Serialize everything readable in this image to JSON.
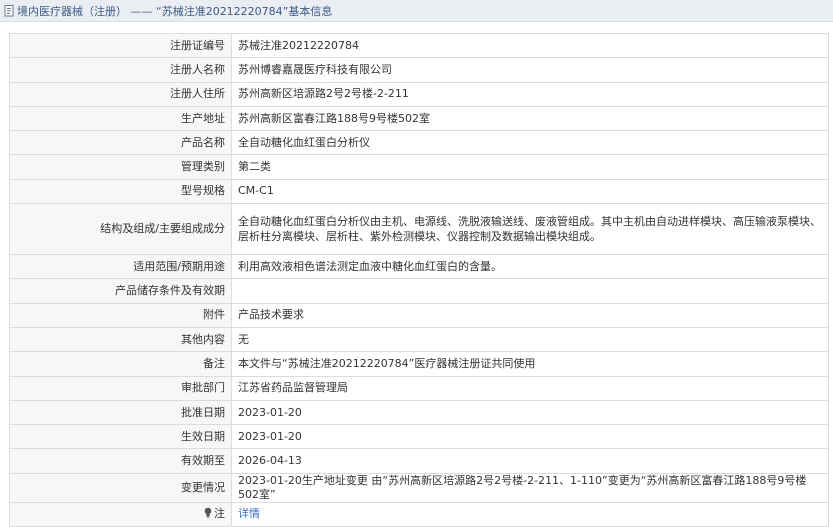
{
  "header": {
    "title": "境内医疗器械（注册） —— “苏械注准20212220784”基本信息"
  },
  "rows": [
    {
      "label": "注册证编号",
      "value": "苏械注准20212220784"
    },
    {
      "label": "注册人名称",
      "value": "苏州博睿嘉晟医疗科技有限公司"
    },
    {
      "label": "注册人住所",
      "value": "苏州高新区培源路2号2号楼-2-211"
    },
    {
      "label": "生产地址",
      "value": "苏州高新区富春江路188号9号楼502室"
    },
    {
      "label": "产品名称",
      "value": "全自动糖化血红蛋白分析仪"
    },
    {
      "label": "管理类别",
      "value": "第二类"
    },
    {
      "label": "型号规格",
      "value": "CM-C1"
    },
    {
      "label": "结构及组成/主要组成成分",
      "value": "全自动糖化血红蛋白分析仪由主机、电源线、洗脱液输送线、废液管组成。其中主机由自动进样模块、高压输液泵模块、层析柱分离模块、层析柱、紫外检测模块、仪器控制及数据输出模块组成。"
    },
    {
      "label": "适用范围/预期用途",
      "value": "利用高效液相色谱法测定血液中糖化血红蛋白的含量。"
    },
    {
      "label": "产品储存条件及有效期",
      "value": ""
    },
    {
      "label": "附件",
      "value": "产品技术要求"
    },
    {
      "label": "其他内容",
      "value": "无"
    },
    {
      "label": "备注",
      "value": "本文件与“苏械注准20212220784”医疗器械注册证共同使用"
    },
    {
      "label": "审批部门",
      "value": "江苏省药品监督管理局"
    },
    {
      "label": "批准日期",
      "value": "2023-01-20"
    },
    {
      "label": "生效日期",
      "value": "2023-01-20"
    },
    {
      "label": "有效期至",
      "value": "2026-04-13"
    },
    {
      "label": "变更情况",
      "value": "2023-01-20生产地址变更 由“苏州高新区培源路2号2号楼-2-211、1-110”变更为“苏州高新区富春江路188号9号楼502室”"
    }
  ],
  "note_row": {
    "label": "注",
    "link_text": "详情",
    "icon": "lightbulb-icon"
  },
  "colors": {
    "header_text": "#3b5a87",
    "header_bg": "#eaedf2",
    "link": "#3a6fc4",
    "border": "#dcdcdc"
  }
}
